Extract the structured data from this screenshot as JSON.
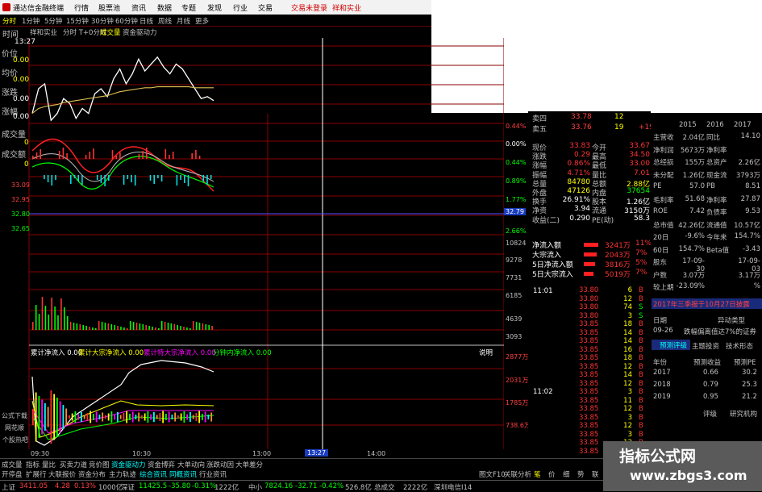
{
  "app": {
    "title": "通达信金融终端",
    "menu": [
      "行情",
      "股票池",
      "资讯",
      "数据",
      "专题",
      "发现",
      "行业",
      "交易"
    ],
    "login_status": "交易未登录",
    "stock_name": "祥和实业"
  },
  "periods": [
    "分时",
    "1分钟",
    "5分钟",
    "15分钟",
    "30分钟",
    "60分钟",
    "日线",
    "周线",
    "月线",
    "更多"
  ],
  "period_selected": "分时",
  "chart_header": {
    "time_label": "时间",
    "stock": "祥和实业",
    "mode": "分时 T+0分时",
    "tag1": "成交量",
    "tag2": "资金驱动力"
  },
  "left_panel": {
    "time_value": "13:27",
    "price_label": "价位",
    "price_value": "0.00",
    "avg_label": "均价",
    "avg_value": "0.00",
    "chg_label": "涨跌",
    "chg_value": "0.00",
    "pct_label": "涨幅",
    "pct_value": "0.00",
    "vol_label": "成交量",
    "vol_value": "0",
    "amt_label": "成交额",
    "amt_value": "0"
  },
  "price_axis_left": [
    "33.09",
    "32.95",
    "32.80",
    "32.65"
  ],
  "price_axis_right": [
    "0.44%",
    "0.00%",
    "0.44%",
    "0.89%",
    "1.33%",
    "1.77%",
    "2.66%"
  ],
  "current_price_tag": "32.79",
  "volume_axis_right": [
    "10824",
    "9278",
    "7731",
    "6185",
    "4639",
    "3093",
    "1546"
  ],
  "flow_header": {
    "net": "累计净流入 0.00",
    "big": "累计大宗净流入 0.00",
    "huge": "累计特大宗净流入 0.00",
    "min": "分钟内净流入 0.00",
    "explain": "说明"
  },
  "flow_axis_right": [
    "2877万",
    "2031万",
    "1785万",
    "738.6万"
  ],
  "side_labels": [
    "公式下载",
    "网花顺",
    "个股热吧"
  ],
  "time_axis": [
    "09:30",
    "10:30",
    "13:00",
    "13:27",
    "14:00"
  ],
  "quote": {
    "sells": [
      {
        "label": "卖四",
        "price": "33.78",
        "vol": "12",
        "extra": ""
      },
      {
        "label": "卖五",
        "price": "33.76",
        "vol": "19",
        "extra": "+19"
      }
    ],
    "rows": [
      {
        "l1": "现价",
        "v1": "33.83",
        "l2": "今开",
        "v2": "33.67"
      },
      {
        "l1": "涨跌",
        "v1": "0.29",
        "l2": "最高",
        "v2": "34.50"
      },
      {
        "l1": "涨幅",
        "v1": "0.86%",
        "l2": "最低",
        "v2": "33.00"
      },
      {
        "l1": "振幅",
        "v1": "4.71%",
        "l2": "量比",
        "v2": "7.01"
      },
      {
        "l1": "总量",
        "v1": "84780",
        "l2": "总额",
        "v2": "2.88亿"
      },
      {
        "l1": "外盘",
        "v1": "47126",
        "l2": "内盘",
        "v2": "37654"
      },
      {
        "l1": "换手",
        "v1": "26.91%",
        "l2": "股本",
        "v2": "1.26亿"
      },
      {
        "l1": "净资",
        "v1": "3.94",
        "l2": "流通",
        "v2": "3150万"
      },
      {
        "l1": "收益(二)",
        "v1": "0.290",
        "l2": "PE(动)",
        "v2": "58.3"
      }
    ],
    "flows": [
      {
        "label": "净流入额",
        "value": "3241万",
        "pct": "11%"
      },
      {
        "label": "大宗流入",
        "value": "2043万",
        "pct": "7%"
      },
      {
        "label": "5日净流入额",
        "value": "3816万",
        "pct": "5%"
      },
      {
        "label": "5日大宗流入",
        "value": "5019万",
        "pct": "7%"
      }
    ]
  },
  "ticks": {
    "times": [
      "11:01",
      "11:02"
    ],
    "prices": [
      "33.80",
      "33.80",
      "33.80",
      "33.80",
      "33.85",
      "33.85",
      "33.85",
      "33.85",
      "33.85",
      "33.85",
      "33.85",
      "33.85",
      "33.85",
      "33.85",
      "33.85",
      "33.85",
      "33.85",
      "33.85",
      "33.85",
      "33.85",
      "33.85",
      "33.85",
      "33.85",
      "33.85",
      "33.85",
      "33.85",
      "33.85",
      "33.85",
      "33.85",
      "33.85",
      "33.85",
      "33.85",
      "33.85"
    ],
    "vols": [
      "6",
      "12",
      "74",
      "3",
      "18",
      "14",
      "14",
      "16",
      "18",
      "12",
      "14",
      "12",
      "3",
      "11",
      "12",
      "3",
      "12",
      "3",
      "12",
      "4",
      "7",
      "6",
      "2",
      "3",
      "3",
      "3",
      "3",
      "12",
      "4",
      "21",
      "3",
      "3",
      "3"
    ],
    "sides": [
      "B",
      "B",
      "S",
      "S",
      "B",
      "B",
      "B",
      "B",
      "B",
      "B",
      "B",
      "B",
      "B",
      "B",
      "B",
      "B",
      "B",
      "B",
      "B",
      "B",
      "B",
      "B",
      "B",
      "B",
      "B",
      "B",
      "B",
      "B",
      "B",
      "B",
      "B",
      "B",
      "B"
    ]
  },
  "fundamentals": {
    "years": [
      "2015",
      "2016",
      "2017"
    ],
    "rows": [
      {
        "l1": "主营收",
        "v1": "2.04亿",
        "l2": "同比",
        "v2": "14.10"
      },
      {
        "l1": "净利润",
        "v1": "5673万",
        "l2": "净利率",
        "v2": ""
      },
      {
        "l1": "总经损",
        "v1": "155万",
        "l2": "总资产",
        "v2": "2.26亿"
      },
      {
        "l1": "未分配",
        "v1": "1.26亿",
        "l2": "现金流",
        "v2": "3793万"
      },
      {
        "l1": "PE",
        "v1": "57.0",
        "l2": "PB",
        "v2": "8.51"
      },
      {
        "l1": "毛利率",
        "v1": "51.68",
        "l2": "净利率",
        "v2": "27.87"
      },
      {
        "l1": "ROE",
        "v1": "7.42",
        "l2": "负债率",
        "v2": "9.53"
      },
      {
        "l1": "总市值",
        "v1": "42.26亿",
        "l2": "流通值",
        "v2": "10.57亿"
      },
      {
        "l1": "20日",
        "v1": "-9.6%",
        "l2": "今年来",
        "v2": "154.7%"
      },
      {
        "l1": "60日",
        "v1": "154.7%",
        "l2": "Beta值",
        "v2": "-3.43"
      },
      {
        "l1": "股东",
        "v1": "17-09-30",
        "l2": "",
        "v2": "17-09-03"
      },
      {
        "l1": "户数",
        "v1": "3.07万",
        "l2": "",
        "v2": "3.17万"
      },
      {
        "l1": "较上期",
        "v1": "-23.09%",
        "l2": "",
        "v2": "%"
      }
    ],
    "notice": "2017年三季报于10月27日披露",
    "event_header": [
      "日期",
      "异动类型"
    ],
    "event": {
      "date": "09-26",
      "text": "跌幅偏离值达7%的证券"
    },
    "subtabs": [
      "预测评级",
      "主题投资",
      "技术形态"
    ],
    "forecast_header": [
      "年份",
      "预测收益",
      "预测PE"
    ],
    "forecast": [
      {
        "year": "2017",
        "eps": "0.66",
        "pe": "30.2"
      },
      {
        "year": "2018",
        "eps": "0.79",
        "pe": "25.3"
      },
      {
        "year": "2019",
        "eps": "0.95",
        "pe": "21.2"
      }
    ],
    "footer": [
      "评级",
      "研究机构"
    ]
  },
  "bottom_tabs": [
    "成交量",
    "指标",
    "量比",
    "买卖力道",
    "竞价图",
    "资金驱动力",
    "资金博弈",
    "大单动向",
    "涨跌动因",
    "大单差分"
  ],
  "bottom_tabs_selected": "资金驱动力",
  "bottom_tabs2": [
    "开停盘",
    "扩展行",
    "大联报价",
    "资金分布",
    "主力轨迹",
    "综合资讯",
    "同概资讯",
    "行业资讯"
  ],
  "right_bottom_tabs": [
    "图文F10",
    "关联分析",
    "笔",
    "价",
    "细",
    "势",
    "联"
  ],
  "status": [
    {
      "name": "上证",
      "val": "3411.05",
      "chg": "4.28",
      "pct": "0.13%",
      "amt": "1000亿"
    },
    {
      "name": "深证",
      "val": "11425.5",
      "chg": "-35.80",
      "pct": "-0.31%",
      "amt": "1222亿"
    },
    {
      "name": "中小",
      "val": "7824.16",
      "chg": "-32.71",
      "pct": "-0.42%",
      "amt": "526.8亿"
    }
  ],
  "status_extra": [
    "总成交",
    "2222亿",
    "深圳电信I14"
  ],
  "watermark": {
    "line1": "指标公式网",
    "line2": "www.zbgs3.com"
  },
  "colors": {
    "up": "#ff3333",
    "down": "#00ff00",
    "label": "#ffff00",
    "grid": "#8a0000"
  },
  "chart_data": [
    {
      "type": "line",
      "title": "分时",
      "series": [
        {
          "name": "",
          "values": [
            33.05,
            33.3,
            33.35,
            32.98,
            33.05,
            33.2,
            33.15,
            33.0,
            33.1,
            33.05,
            33.25,
            33.3,
            33.22,
            33.4,
            33.5,
            33.35,
            33.45,
            33.6,
            33.48,
            33.55,
            33.62,
            33.52,
            33.45,
            33.55,
            33.5,
            33.4,
            33.3,
            33.2,
            33.22,
            33.18
          ]
        },
        {
          "name": "",
          "values": [
            33.05,
            33.1,
            33.12,
            33.13,
            33.14,
            33.16,
            33.17,
            33.18,
            33.19,
            33.2,
            33.21,
            33.22,
            33.23,
            33.25,
            33.27,
            33.28,
            33.29,
            33.3,
            33.31,
            33.31,
            33.32,
            33.32,
            33.32,
            33.32,
            33.32,
            33.32,
            33.31,
            33.31,
            33.31,
            33.31
          ]
        }
      ]
    }
  ]
}
